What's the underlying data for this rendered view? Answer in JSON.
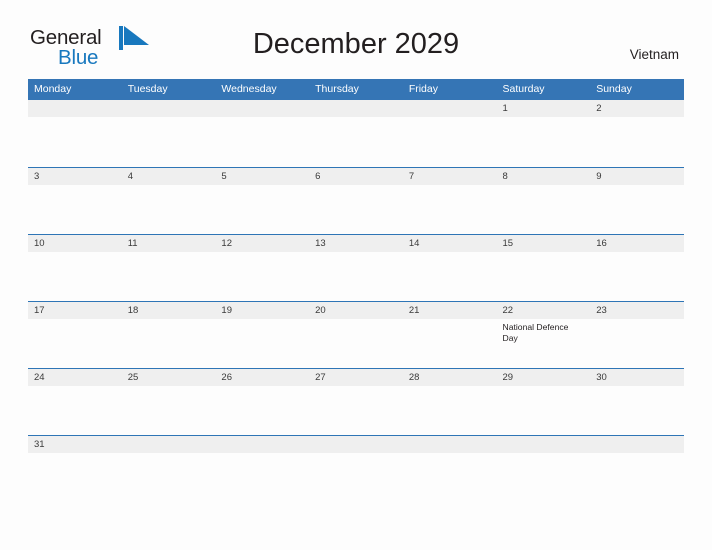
{
  "brand": {
    "name_part1": "General",
    "name_part2": "Blue",
    "flag_color": "#1878be"
  },
  "header": {
    "title": "December 2029",
    "country": "Vietnam"
  },
  "theme": {
    "header_blue": "#3575b5",
    "rule_blue": "#2e75b6",
    "daynum_band": "#efefef",
    "page_background": "#fdfdfd",
    "text": "#231f20"
  },
  "weekdays": [
    "Monday",
    "Tuesday",
    "Wednesday",
    "Thursday",
    "Friday",
    "Saturday",
    "Sunday"
  ],
  "weeks": [
    {
      "days": [
        {
          "num": "",
          "event": ""
        },
        {
          "num": "",
          "event": ""
        },
        {
          "num": "",
          "event": ""
        },
        {
          "num": "",
          "event": ""
        },
        {
          "num": "",
          "event": ""
        },
        {
          "num": "1",
          "event": ""
        },
        {
          "num": "2",
          "event": ""
        }
      ]
    },
    {
      "days": [
        {
          "num": "3",
          "event": ""
        },
        {
          "num": "4",
          "event": ""
        },
        {
          "num": "5",
          "event": ""
        },
        {
          "num": "6",
          "event": ""
        },
        {
          "num": "7",
          "event": ""
        },
        {
          "num": "8",
          "event": ""
        },
        {
          "num": "9",
          "event": ""
        }
      ]
    },
    {
      "days": [
        {
          "num": "10",
          "event": ""
        },
        {
          "num": "11",
          "event": ""
        },
        {
          "num": "12",
          "event": ""
        },
        {
          "num": "13",
          "event": ""
        },
        {
          "num": "14",
          "event": ""
        },
        {
          "num": "15",
          "event": ""
        },
        {
          "num": "16",
          "event": ""
        }
      ]
    },
    {
      "days": [
        {
          "num": "17",
          "event": ""
        },
        {
          "num": "18",
          "event": ""
        },
        {
          "num": "19",
          "event": ""
        },
        {
          "num": "20",
          "event": ""
        },
        {
          "num": "21",
          "event": ""
        },
        {
          "num": "22",
          "event": "National Defence Day"
        },
        {
          "num": "23",
          "event": ""
        }
      ]
    },
    {
      "days": [
        {
          "num": "24",
          "event": ""
        },
        {
          "num": "25",
          "event": ""
        },
        {
          "num": "26",
          "event": ""
        },
        {
          "num": "27",
          "event": ""
        },
        {
          "num": "28",
          "event": ""
        },
        {
          "num": "29",
          "event": ""
        },
        {
          "num": "30",
          "event": ""
        }
      ]
    },
    {
      "days": [
        {
          "num": "31",
          "event": ""
        },
        {
          "num": "",
          "event": ""
        },
        {
          "num": "",
          "event": ""
        },
        {
          "num": "",
          "event": ""
        },
        {
          "num": "",
          "event": ""
        },
        {
          "num": "",
          "event": ""
        },
        {
          "num": "",
          "event": ""
        }
      ]
    }
  ]
}
